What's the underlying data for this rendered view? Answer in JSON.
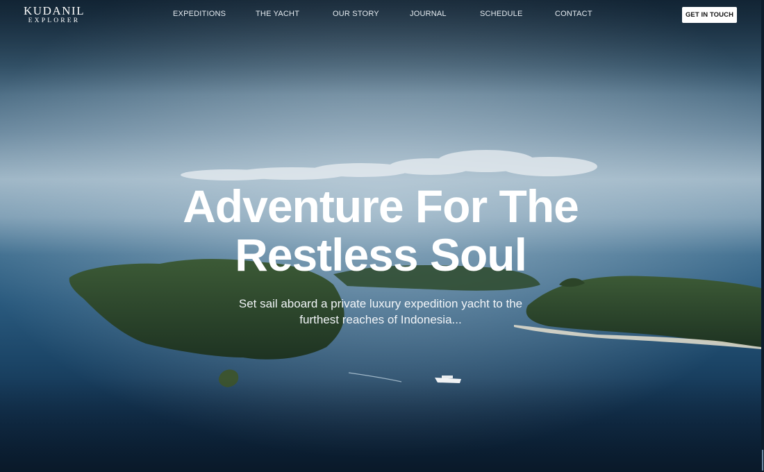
{
  "brand": {
    "name_top": "KUDANIL",
    "name_bottom": "EXPLORER"
  },
  "nav": {
    "items": [
      {
        "label": "EXPEDITIONS"
      },
      {
        "label": "THE YACHT"
      },
      {
        "label": "OUR STORY"
      },
      {
        "label": "JOURNAL"
      },
      {
        "label": "SCHEDULE"
      },
      {
        "label": "CONTACT"
      }
    ],
    "cta_label": "GET IN TOUCH"
  },
  "hero": {
    "headline_line1": "Adventure For The",
    "headline_line2": "Restless Soul",
    "subhead_line1": "Set sail aboard a private luxury expedition yacht to the",
    "subhead_line2": "furthest reaches of Indonesia..."
  },
  "colors": {
    "text": "#ffffff",
    "cta_background": "#ffffff",
    "cta_text": "#111111",
    "sea_dark": "#0b2036",
    "sea_mid": "#2a5a7e"
  }
}
